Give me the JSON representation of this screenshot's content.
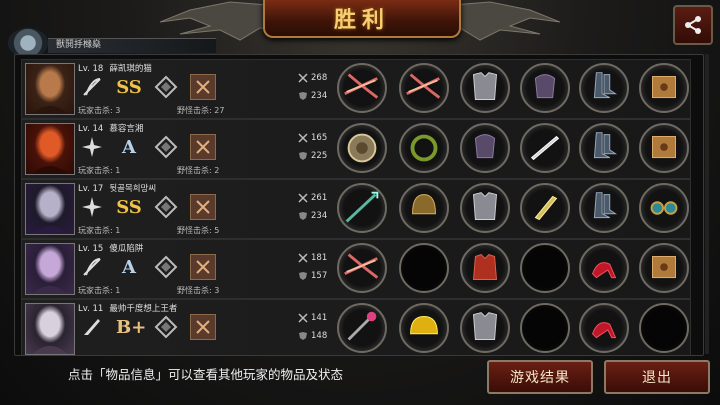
{
  "header": {
    "title": "胜利",
    "player_name": "獸鬨抙橼燊"
  },
  "colors": {
    "accent": "#f6cf72",
    "panel": "#0d0d0d",
    "button": "#6a1f14"
  },
  "kills_label": {
    "player": "玩家击杀",
    "monster": "野怪击杀"
  },
  "players": [
    {
      "level": "Lv. 18",
      "name": "薛凯琪的猫",
      "rank": "SS",
      "class_icon": "bow-icon",
      "player_kills": "玩家击杀: 3",
      "monster_kills": "野怪击杀: 27",
      "attack": "268",
      "defense": "234",
      "items": [
        "crossbow-item",
        "crossbow-item",
        "chest-armor-item",
        "gauntlet-item",
        "boots-item",
        "loot-box-item"
      ]
    },
    {
      "level": "Lv. 14",
      "name": "慕容言湘",
      "rank": "A",
      "class_icon": "shuriken-icon",
      "player_kills": "玩家击杀: 1",
      "monster_kills": "野怪击杀: 2",
      "attack": "165",
      "defense": "225",
      "items": [
        "shield-item",
        "wreath-item",
        "gauntlet-item",
        "sword-item",
        "boots-item",
        "loot-box-item"
      ]
    },
    {
      "level": "Lv. 17",
      "name": "뒷골목희망씨",
      "rank": "SS",
      "class_icon": "shuriken-icon",
      "player_kills": "玩家击杀: 1",
      "monster_kills": "野怪击杀: 5",
      "attack": "261",
      "defense": "234",
      "items": [
        "spear-item",
        "helmet-item",
        "chest-armor-item",
        "dagger-item",
        "boots-item",
        "goggles-item"
      ]
    },
    {
      "level": "Lv. 15",
      "name": "傻瓜陷阱",
      "rank": "A",
      "class_icon": "bow-icon",
      "player_kills": "玩家击杀: 1",
      "monster_kills": "野怪击杀: 3",
      "attack": "181",
      "defense": "157",
      "items": [
        "crossbow-item",
        "empty",
        "jacket-item",
        "empty",
        "heels-item",
        "loot-box-item"
      ]
    },
    {
      "level": "Lv. 11",
      "name": "最帅千度想上王者",
      "rank": "B+",
      "class_icon": "knife-icon",
      "player_kills": "",
      "monster_kills": "",
      "attack": "141",
      "defense": "148",
      "items": [
        "scepter-item",
        "hardhat-item",
        "chest-armor-item",
        "empty",
        "heels-item",
        "empty"
      ]
    }
  ],
  "footer": {
    "hint": "点击「物品信息」可以查看其他玩家的物品及状态",
    "result_button": "游戏结果",
    "exit_button": "退出"
  }
}
